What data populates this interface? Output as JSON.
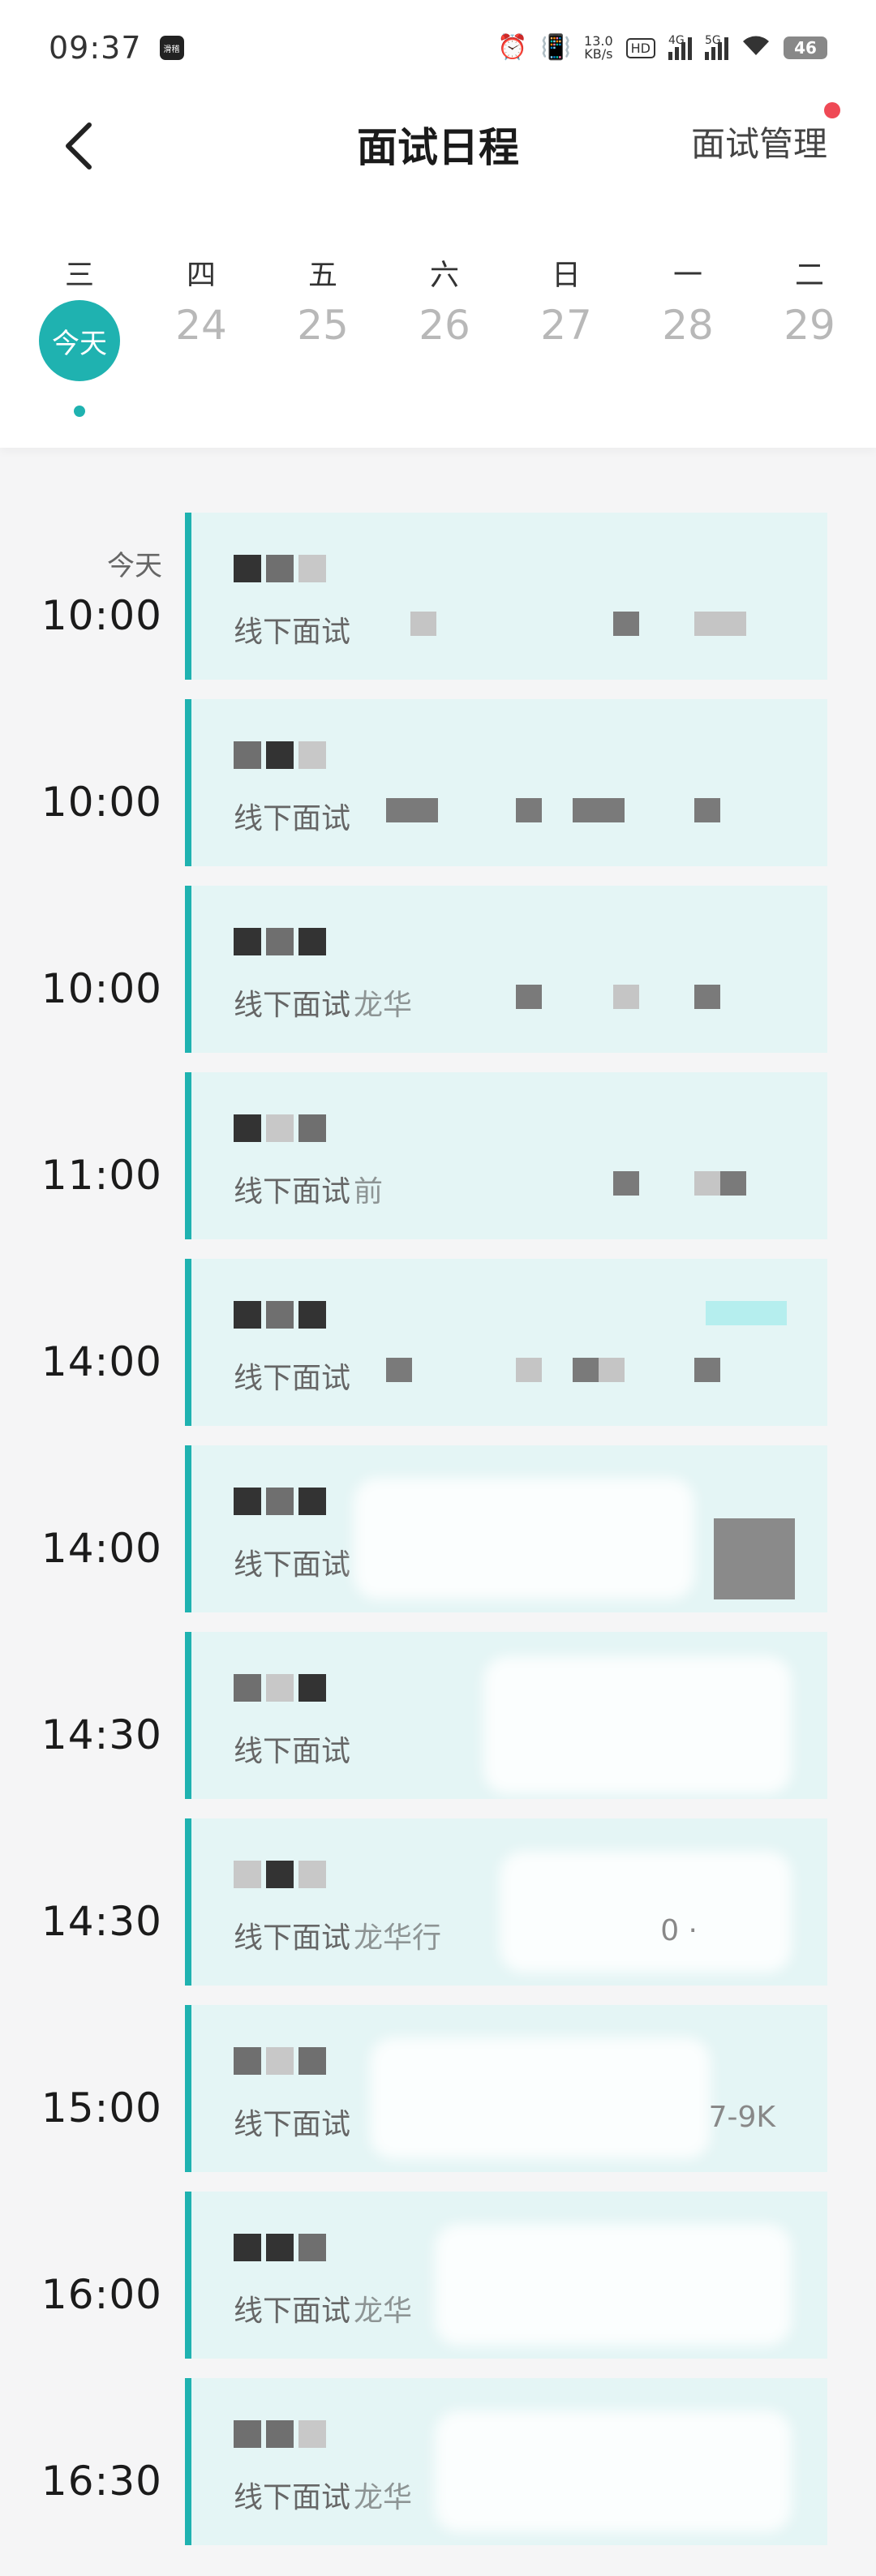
{
  "status_bar": {
    "time": "09:37",
    "app_icon_label": "滑稽",
    "net_speed_value": "13.0",
    "net_speed_unit": "KB/s",
    "hd_badge": "HD",
    "signal_1_label": "4G",
    "signal_2_label": "5G",
    "battery": "46"
  },
  "header": {
    "title": "面试日程",
    "manage_label": "面试管理"
  },
  "week": {
    "days": [
      {
        "weekday": "三",
        "date": "今天",
        "is_today": true
      },
      {
        "weekday": "四",
        "date": "24"
      },
      {
        "weekday": "五",
        "date": "25"
      },
      {
        "weekday": "六",
        "date": "26"
      },
      {
        "weekday": "日",
        "date": "27"
      },
      {
        "weekday": "一",
        "date": "28"
      },
      {
        "weekday": "二",
        "date": "29"
      }
    ]
  },
  "schedule": {
    "today_label": "今天",
    "items": [
      {
        "time": "10:00",
        "type": "线下面试",
        "detail": "",
        "extra": ""
      },
      {
        "time": "10:00",
        "type": "线下面试",
        "detail": "",
        "extra": ""
      },
      {
        "time": "10:00",
        "type": "线下面试",
        "detail": "龙华",
        "extra": ""
      },
      {
        "time": "11:00",
        "type": "线下面试",
        "detail": "前",
        "extra": ""
      },
      {
        "time": "14:00",
        "type": "线下面试",
        "detail": "",
        "extra": ""
      },
      {
        "time": "14:00",
        "type": "线下面试",
        "detail": "",
        "extra": ""
      },
      {
        "time": "14:30",
        "type": "线下面试",
        "detail": "",
        "extra": ""
      },
      {
        "time": "14:30",
        "type": "线下面试",
        "detail": "龙华行",
        "extra": "0 ·"
      },
      {
        "time": "15:00",
        "type": "线下面试",
        "detail": "",
        "extra": "7-9K"
      },
      {
        "time": "16:00",
        "type": "线下面试",
        "detail": "龙华",
        "extra": ""
      },
      {
        "time": "16:30",
        "type": "线下面试",
        "detail": "龙华",
        "extra": ""
      }
    ]
  }
}
